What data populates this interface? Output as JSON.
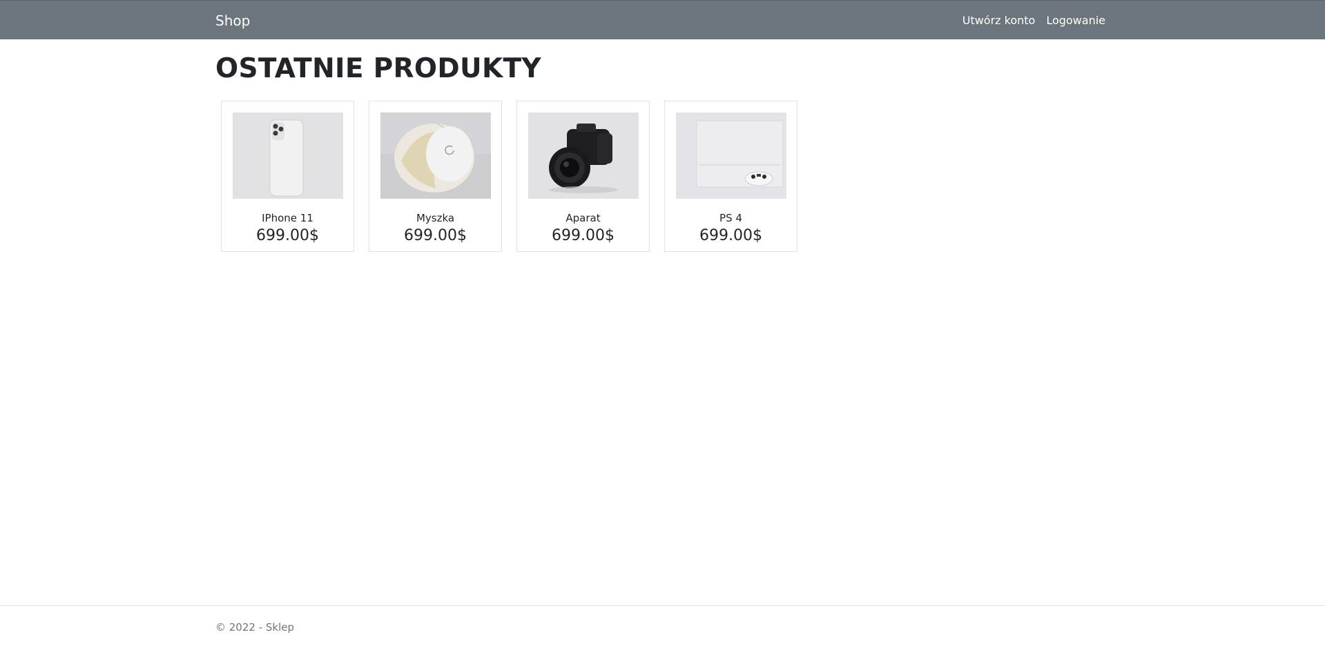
{
  "navbar": {
    "brand": "Shop",
    "links": [
      {
        "label": "Utwórz konto"
      },
      {
        "label": "Logowanie"
      }
    ]
  },
  "main": {
    "title": "OSTATNIE PRODUKTY",
    "products": [
      {
        "name": "IPhone 11",
        "price": "699.00$",
        "image_icon": "iphone-image"
      },
      {
        "name": "Myszka",
        "price": "699.00$",
        "image_icon": "mouse-image"
      },
      {
        "name": "Aparat",
        "price": "699.00$",
        "image_icon": "camera-image"
      },
      {
        "name": "PS 4",
        "price": "699.00$",
        "image_icon": "ps4-image"
      }
    ]
  },
  "footer": {
    "text": "© 2022 - Sklep"
  },
  "colors": {
    "navbar_bg": "#6c757d",
    "text": "#212529",
    "muted": "#6c757d",
    "border": "#dee2e6"
  }
}
